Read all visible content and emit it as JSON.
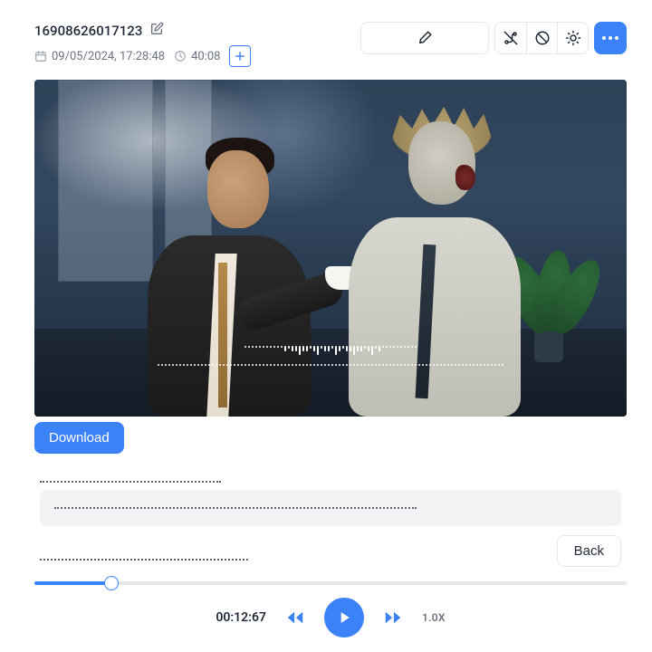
{
  "title": "16908626017123",
  "metadata": {
    "date": "09/05/2024, 17:28:48",
    "duration": "40:08"
  },
  "toolbar": {
    "edit_title_icon": "pencil-square",
    "add_icon": "plus",
    "edit_icon": "pencil",
    "route_icon": "route-off",
    "block_icon": "circle-slash",
    "brightness_icon": "sun",
    "more_icon": "dots"
  },
  "actions": {
    "download": "Download",
    "back": "Back"
  },
  "form": {
    "line1_placeholder": "",
    "line2_placeholder": "",
    "line3_placeholder": ""
  },
  "player": {
    "current_time": "00:12:67",
    "progress_percent": 13,
    "speed": "1.0X"
  },
  "colors": {
    "primary": "#3b82f6",
    "muted": "#6b7280",
    "border": "#e5e7eb"
  }
}
